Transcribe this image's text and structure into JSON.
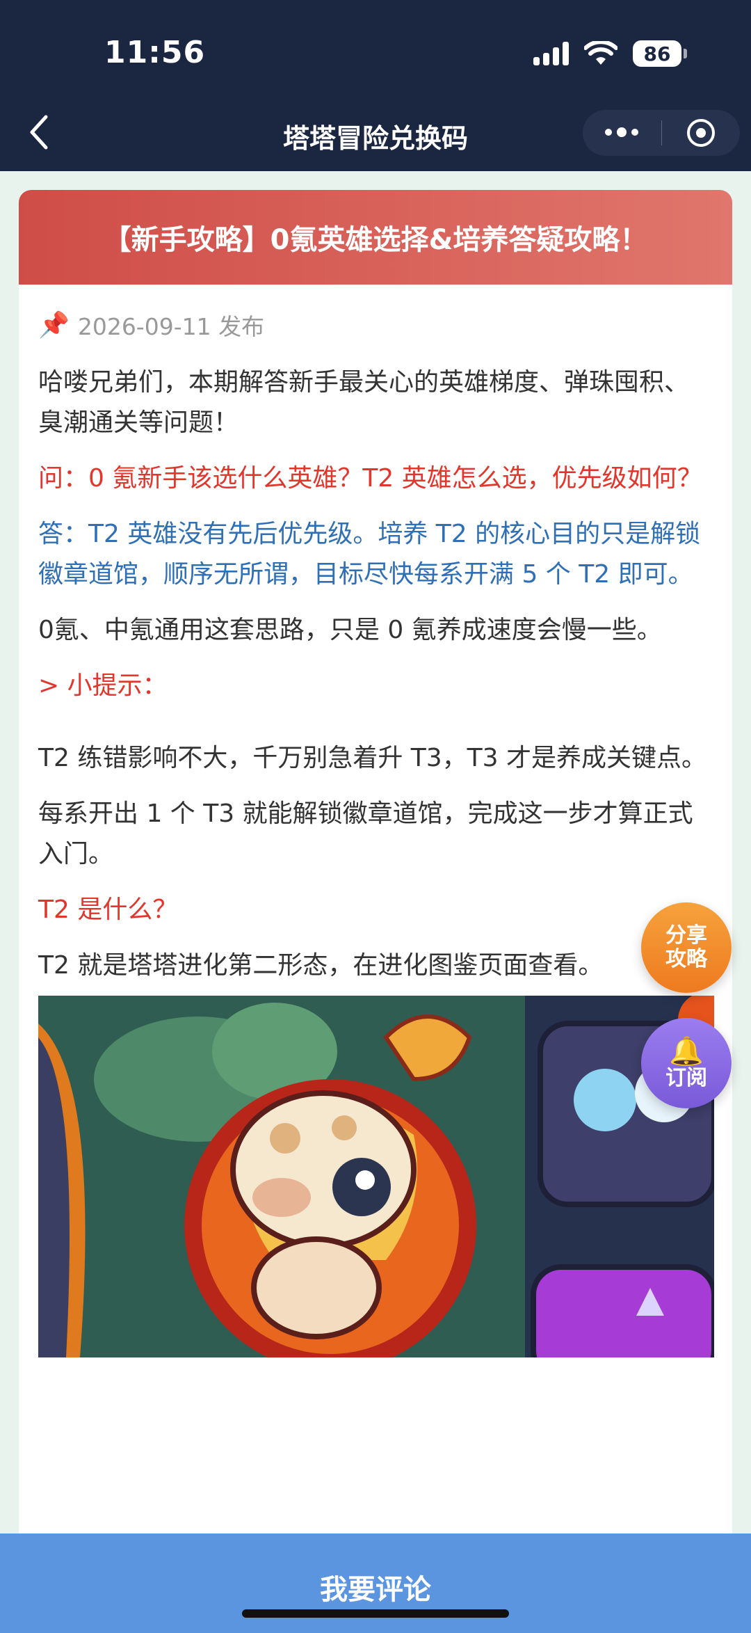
{
  "status_bar": {
    "time": "11:56",
    "battery": "86"
  },
  "nav": {
    "title": "塔塔冒险兑换码"
  },
  "article": {
    "title": "【新手攻略】0氪英雄选择&培养答疑攻略！",
    "date": "2026-09-11 发布",
    "paragraphs": [
      "哈喽兄弟们，本期解答新手最关心的英雄梯度、弹珠囤积、臭潮通关等问题！",
      "问：0 氪新手该选什么英雄？T2 英雄怎么选，优先级如何？",
      "答：T2 英雄没有先后优先级。培养 T2 的核心目的只是解锁徽章道馆，顺序无所谓，目标尽快每系开满 5 个 T2 即可。",
      "0氪、中氪通用这套思路，只是 0 氪养成速度会慢一些。",
      "> 小提示：",
      "T2 练错影响不大，千万别急着升 T3，T3 才是养成关键点。",
      "每系开出 1 个 T3 就能解锁徽章道馆，完成这一步才算正式入门。",
      "T2 是什么？",
      "T2 就是塔塔进化第二形态，在进化图鉴页面查看。"
    ]
  },
  "floating": {
    "share": "分享攻略",
    "share_line1": "分享",
    "share_line2": "攻略",
    "subscribe": "订阅"
  },
  "bottom": {
    "comment": "我要评论"
  },
  "colors": {
    "header_red": "#d9564f",
    "question_red": "#e2352b",
    "answer_blue": "#2f6fb5",
    "bottom_blue": "#5b95e0"
  }
}
